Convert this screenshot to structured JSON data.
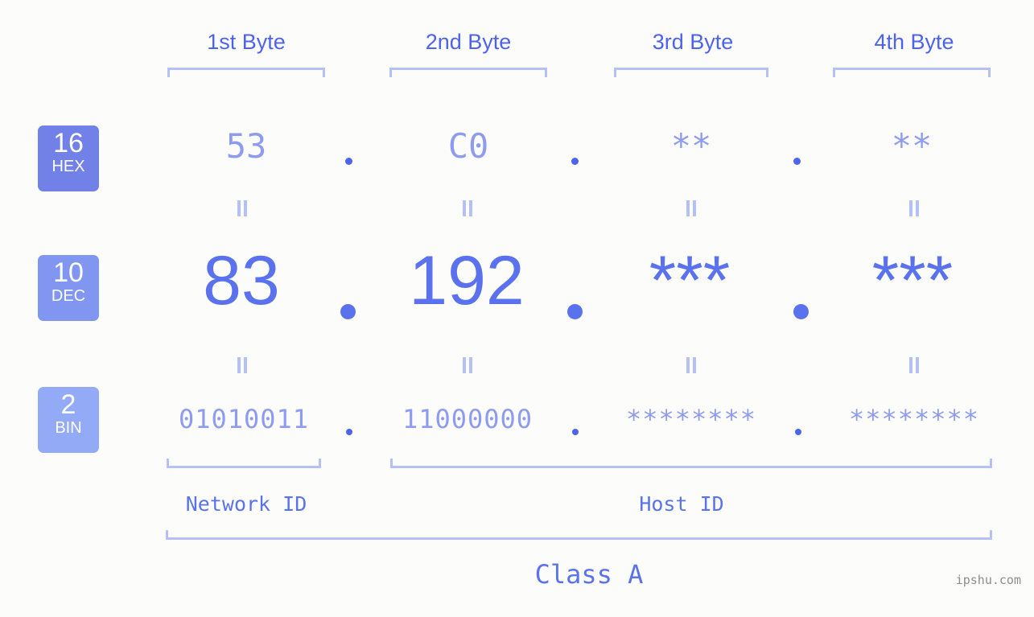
{
  "background_color": "#fcfdfa",
  "accent_colors": {
    "strong_blue": "#4d63ee",
    "mid_blue": "#5a72ed",
    "light_blue": "#8d9bf0",
    "bracket": "#b5c0f7",
    "badge_hex": "#7181e8",
    "badge_dec": "#8096f0",
    "badge_bin": "#93aaf7",
    "watermark_gray": "#8c8c8c"
  },
  "byte_headers": [
    {
      "label": "1st Byte"
    },
    {
      "label": "2nd Byte"
    },
    {
      "label": "3rd Byte"
    },
    {
      "label": "4th Byte"
    }
  ],
  "bases": [
    {
      "number": "16",
      "abbr": "HEX"
    },
    {
      "number": "10",
      "abbr": "DEC"
    },
    {
      "number": "2",
      "abbr": "BIN"
    }
  ],
  "rows": {
    "hex": {
      "base_number": "16",
      "base_abbr": "HEX",
      "values": [
        "53",
        "C0",
        "**",
        "**"
      ],
      "separators": [
        ".",
        ".",
        "."
      ]
    },
    "dec": {
      "base_number": "10",
      "base_abbr": "DEC",
      "values": [
        "83",
        "192",
        "***",
        "***"
      ],
      "separators": [
        ".",
        ".",
        "."
      ]
    },
    "bin": {
      "base_number": "2",
      "base_abbr": "BIN",
      "values": [
        "01010011",
        "11000000",
        "********",
        "********"
      ],
      "separators": [
        ".",
        ".",
        "."
      ]
    }
  },
  "equals_symbols": {
    "row1": [
      "=",
      "=",
      "=",
      "="
    ],
    "row2": [
      "=",
      "=",
      "=",
      "="
    ]
  },
  "regions": [
    {
      "label": "Network ID"
    },
    {
      "label": "Host ID"
    }
  ],
  "class": {
    "label": "Class A"
  },
  "watermark": {
    "text": "ipshu.com"
  }
}
